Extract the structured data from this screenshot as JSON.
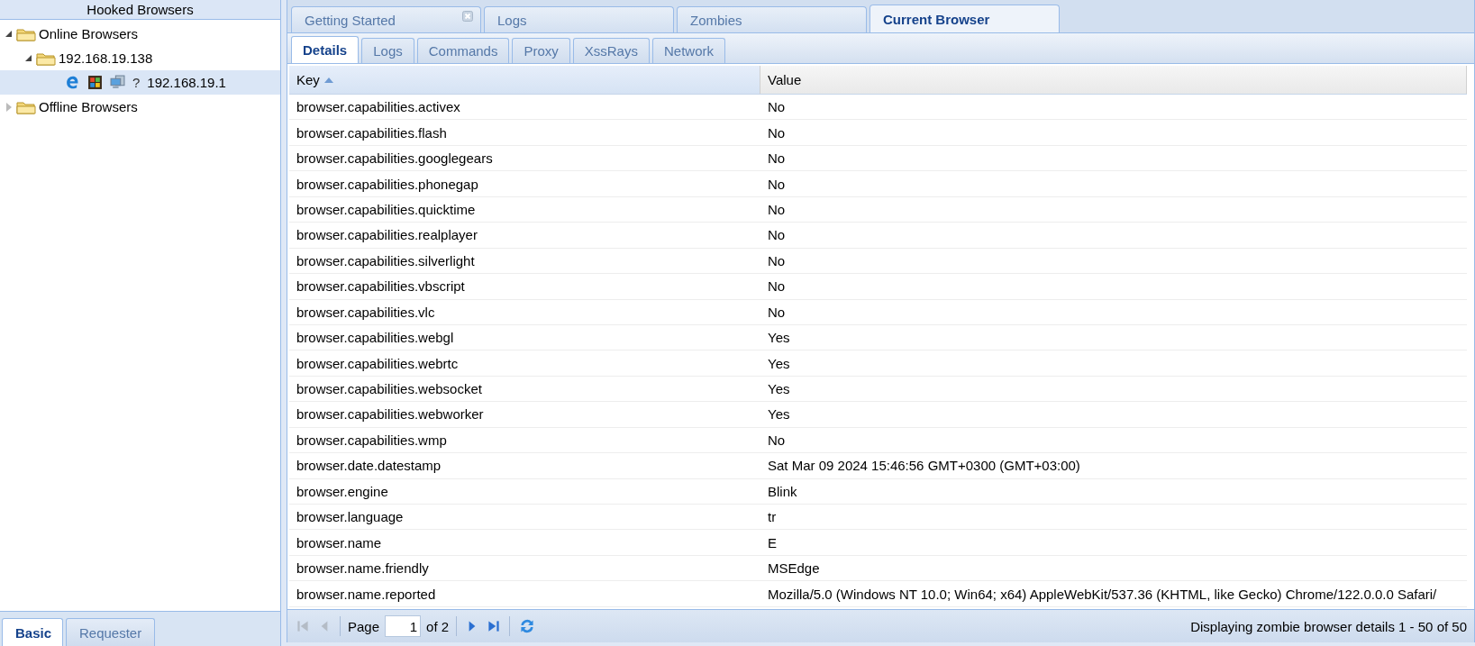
{
  "sidebar": {
    "title": "Hooked Browsers",
    "tree": [
      {
        "label": "Online Browsers",
        "kind": "folder",
        "expanded": true,
        "selected": false,
        "children": [
          {
            "label": "192.168.19.138",
            "kind": "folder",
            "expanded": true,
            "selected": false,
            "children": [
              {
                "label": "192.168.19.1",
                "kind": "browser",
                "selected": true,
                "status_glyph": "?"
              }
            ]
          }
        ]
      },
      {
        "label": "Offline Browsers",
        "kind": "folder",
        "expanded": false,
        "selected": false
      }
    ],
    "tabs": [
      {
        "label": "Basic",
        "selected": true
      },
      {
        "label": "Requester",
        "selected": false
      }
    ]
  },
  "main_tabs": [
    {
      "label": "Getting Started",
      "selected": false,
      "closable": true
    },
    {
      "label": "Logs",
      "selected": false,
      "closable": false
    },
    {
      "label": "Zombies",
      "selected": false,
      "closable": false
    },
    {
      "label": "Current Browser",
      "selected": true,
      "closable": false
    }
  ],
  "sub_tabs": [
    {
      "label": "Details",
      "selected": true
    },
    {
      "label": "Logs",
      "selected": false
    },
    {
      "label": "Commands",
      "selected": false
    },
    {
      "label": "Proxy",
      "selected": false
    },
    {
      "label": "XssRays",
      "selected": false
    },
    {
      "label": "Network",
      "selected": false
    }
  ],
  "table": {
    "columns": [
      {
        "label": "Key",
        "sorted": true
      },
      {
        "label": "Value",
        "sorted": false
      }
    ],
    "rows": [
      [
        "browser.capabilities.activex",
        "No"
      ],
      [
        "browser.capabilities.flash",
        "No"
      ],
      [
        "browser.capabilities.googlegears",
        "No"
      ],
      [
        "browser.capabilities.phonegap",
        "No"
      ],
      [
        "browser.capabilities.quicktime",
        "No"
      ],
      [
        "browser.capabilities.realplayer",
        "No"
      ],
      [
        "browser.capabilities.silverlight",
        "No"
      ],
      [
        "browser.capabilities.vbscript",
        "No"
      ],
      [
        "browser.capabilities.vlc",
        "No"
      ],
      [
        "browser.capabilities.webgl",
        "Yes"
      ],
      [
        "browser.capabilities.webrtc",
        "Yes"
      ],
      [
        "browser.capabilities.websocket",
        "Yes"
      ],
      [
        "browser.capabilities.webworker",
        "Yes"
      ],
      [
        "browser.capabilities.wmp",
        "No"
      ],
      [
        "browser.date.datestamp",
        "Sat Mar 09 2024 15:46:56 GMT+0300 (GMT+03:00)"
      ],
      [
        "browser.engine",
        "Blink"
      ],
      [
        "browser.language",
        "tr"
      ],
      [
        "browser.name",
        "E"
      ],
      [
        "browser.name.friendly",
        "MSEdge"
      ],
      [
        "browser.name.reported",
        "Mozilla/5.0 (Windows NT 10.0; Win64; x64) AppleWebKit/537.36 (KHTML, like Gecko) Chrome/122.0.0.0 Safari/"
      ]
    ]
  },
  "paging": {
    "page_label": "Page",
    "page_value": "1",
    "of_label": "of 2",
    "status": "Displaying zombie browser details 1 - 50 of 50"
  }
}
